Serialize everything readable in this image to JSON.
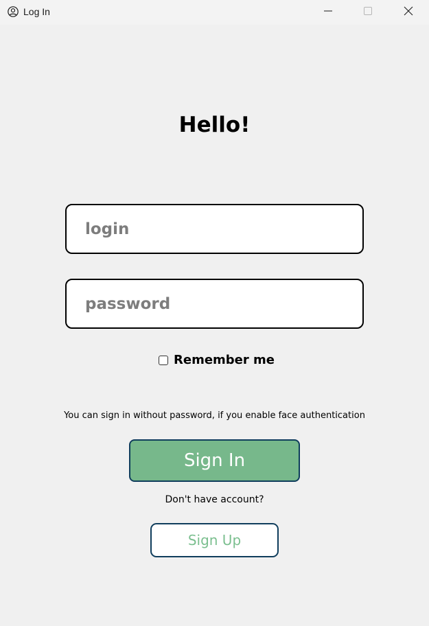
{
  "window": {
    "title": "Log In"
  },
  "title_bar": {
    "icons": {
      "app": "user-circle-icon",
      "minimize": "minimize-icon",
      "maximize": "maximize-icon",
      "close": "close-icon"
    }
  },
  "main": {
    "heading": "Hello!",
    "login_placeholder": "login",
    "login_value": "",
    "password_placeholder": "password",
    "password_value": "",
    "remember_label": "Remember me",
    "remember_checked": false,
    "face_auth_hint": "You can sign in without password, if you enable face authentication",
    "sign_in_label": "Sign In",
    "no_account_text": "Don't have account?",
    "sign_up_label": "Sign Up"
  },
  "colors": {
    "background": "#f0f0f0",
    "sign_in_fill": "#77b88b",
    "button_border": "#0f3d5c",
    "sign_up_text": "#7bbf8f"
  }
}
